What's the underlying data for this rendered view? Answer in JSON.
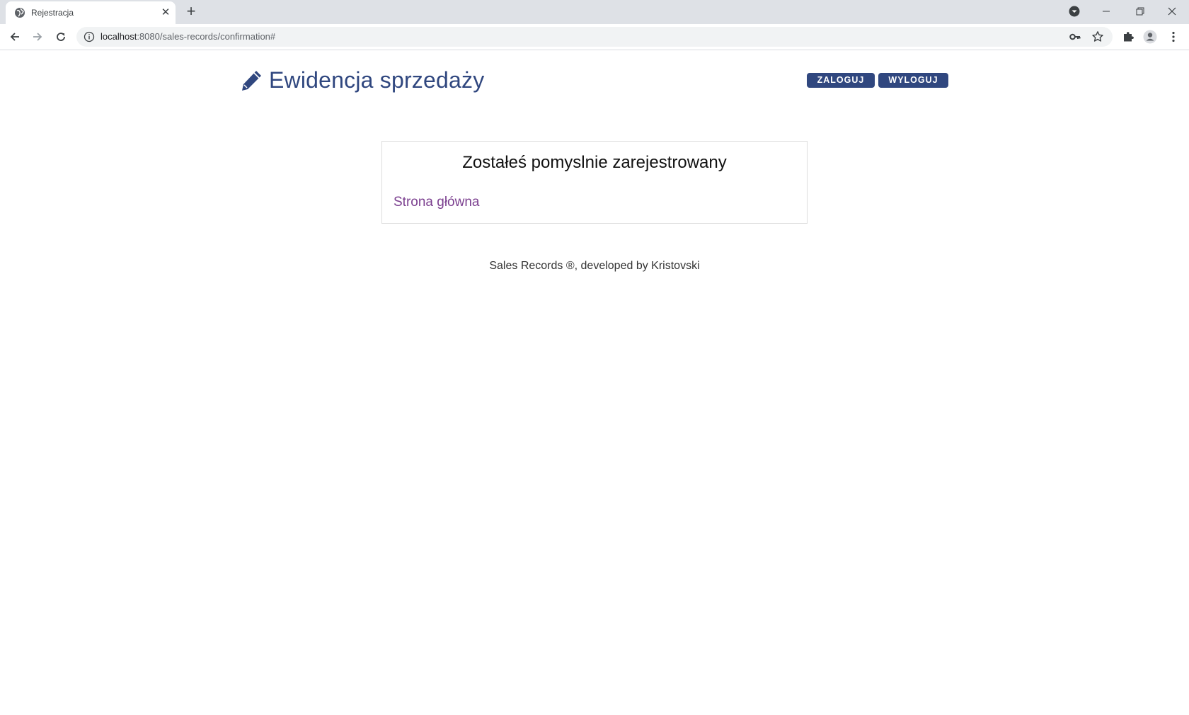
{
  "browser": {
    "tab_title": "Rejestracja",
    "url_host": "localhost",
    "url_rest": ":8080/sales-records/confirmation#"
  },
  "header": {
    "brand_title": "Ewidencja sprzedaży",
    "brand_icon": "pencil-icon",
    "login_label": "ZALOGUJ",
    "logout_label": "WYLOGUJ"
  },
  "card": {
    "title": "Zostałeś pomyslnie zarejestrowany",
    "home_link": "Strona główna"
  },
  "footer": {
    "text": "Sales Records ®, developed by Kristovski"
  },
  "colors": {
    "brand": "#30477f",
    "link": "#7b3f8f"
  }
}
